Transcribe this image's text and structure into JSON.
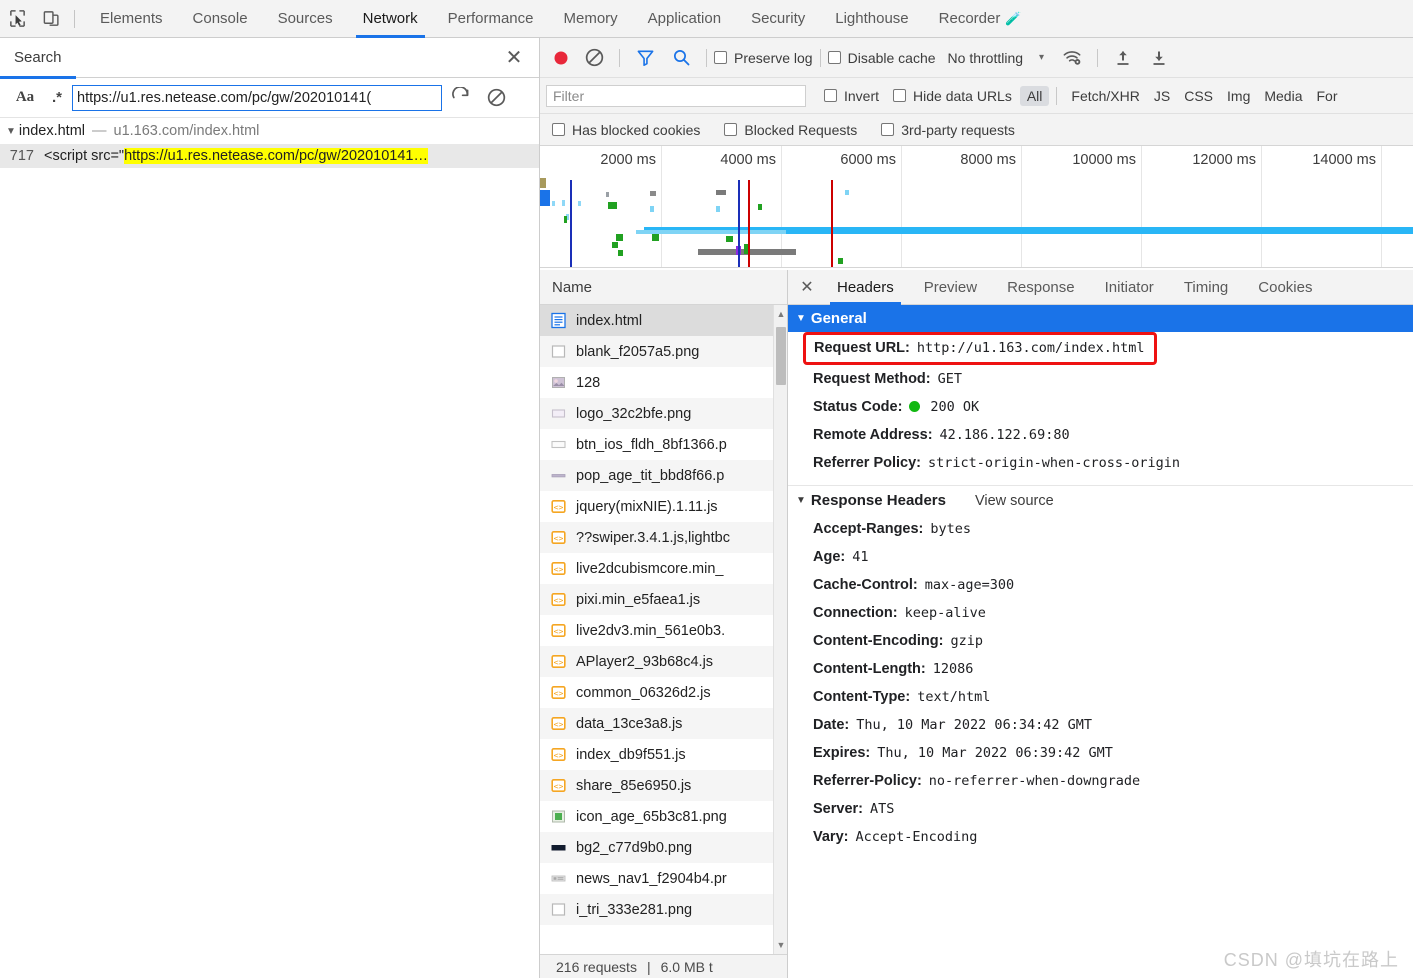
{
  "devtools": {
    "tabs": [
      {
        "label": "Elements",
        "active": false
      },
      {
        "label": "Console",
        "active": false
      },
      {
        "label": "Sources",
        "active": false
      },
      {
        "label": "Network",
        "active": true
      },
      {
        "label": "Performance",
        "active": false
      },
      {
        "label": "Memory",
        "active": false
      },
      {
        "label": "Application",
        "active": false
      },
      {
        "label": "Security",
        "active": false
      },
      {
        "label": "Lighthouse",
        "active": false
      },
      {
        "label": "Recorder",
        "active": false,
        "badge": "flask-icon"
      }
    ],
    "inspect_icon": "inspect-cursor-icon",
    "device_icon": "device-toolbar-icon",
    "accent_color": "#1a73e8"
  },
  "search_drawer": {
    "title": "Search",
    "close_icon": "close-icon",
    "match_case_label": "Aa",
    "regex_label": ".*",
    "query_value": "https://u1.res.netease.com/pc/gw/202010141(",
    "query_placeholder": "",
    "refresh_icon": "refresh-icon",
    "clear_icon": "clear-icon",
    "results": {
      "file": "index.html",
      "separator": "—",
      "file_url": "u1.163.com/index.html",
      "matches": [
        {
          "line": "717",
          "prefix": "<script src=\"",
          "highlight": "https://u1.res.netease.com/pc/gw/202010141…"
        }
      ]
    }
  },
  "network": {
    "toolbar": {
      "record_icon": "record-stop-icon",
      "clear_icon": "clear-network-icon",
      "filter_icon": "filter-icon",
      "search_icon": "search-icon",
      "preserve_log": {
        "label": "Preserve log",
        "checked": false
      },
      "disable_cache": {
        "label": "Disable cache",
        "checked": false
      },
      "throttling": "No throttling",
      "throttling_caret": "▾",
      "network_conditions_icon": "wifi-settings-icon",
      "import_icon": "import-har-icon",
      "export_icon": "export-har-icon"
    },
    "filter": {
      "placeholder": "Filter",
      "value": "",
      "invert": {
        "label": "Invert",
        "checked": false
      },
      "hide_data_urls": {
        "label": "Hide data URLs",
        "checked": false
      },
      "types": [
        {
          "label": "All",
          "selected": true
        },
        {
          "label": "Fetch/XHR",
          "selected": false
        },
        {
          "label": "JS",
          "selected": false
        },
        {
          "label": "CSS",
          "selected": false
        },
        {
          "label": "Img",
          "selected": false
        },
        {
          "label": "Media",
          "selected": false
        },
        {
          "label": "For",
          "selected": false
        }
      ]
    },
    "checkboxes": [
      {
        "label": "Has blocked cookies",
        "checked": false
      },
      {
        "label": "Blocked Requests",
        "checked": false
      },
      {
        "label": "3rd-party requests",
        "checked": false
      }
    ],
    "overview": {
      "ticks": [
        "2000 ms",
        "4000 ms",
        "6000 ms",
        "8000 ms",
        "10000 ms",
        "12000 ms",
        "14000 ms"
      ],
      "dom_content_loaded_color": "#1a2fb8",
      "load_color": "#cc0000"
    },
    "list": {
      "column_header": "Name",
      "rows": [
        {
          "name": "index.html",
          "icon": "document-icon",
          "selected": true
        },
        {
          "name": "blank_f2057a5.png",
          "icon": "image-icon",
          "selected": false
        },
        {
          "name": "128",
          "icon": "image-thumb-icon",
          "selected": false
        },
        {
          "name": "logo_32c2bfe.png",
          "icon": "image-icon",
          "selected": false
        },
        {
          "name": "btn_ios_fldh_8bf1366.p",
          "icon": "image-icon",
          "selected": false
        },
        {
          "name": "pop_age_tit_bbd8f66.p",
          "icon": "image-icon",
          "selected": false
        },
        {
          "name": "jquery(mixNIE).1.11.js",
          "icon": "script-icon",
          "selected": false
        },
        {
          "name": "??swiper.3.4.1.js,lightbc",
          "icon": "script-icon",
          "selected": false
        },
        {
          "name": "live2dcubismcore.min_",
          "icon": "script-icon",
          "selected": false
        },
        {
          "name": "pixi.min_e5faea1.js",
          "icon": "script-icon",
          "selected": false
        },
        {
          "name": "live2dv3.min_561e0b3.",
          "icon": "script-icon",
          "selected": false
        },
        {
          "name": "APlayer2_93b68c4.js",
          "icon": "script-icon",
          "selected": false
        },
        {
          "name": "common_06326d2.js",
          "icon": "script-icon",
          "selected": false
        },
        {
          "name": "data_13ce3a8.js",
          "icon": "script-icon",
          "selected": false
        },
        {
          "name": "index_db9f551.js",
          "icon": "script-icon",
          "selected": false
        },
        {
          "name": "share_85e6950.js",
          "icon": "script-icon",
          "selected": false
        },
        {
          "name": "icon_age_65b3c81.png",
          "icon": "image-thumb-icon",
          "selected": false
        },
        {
          "name": "bg2_c77d9b0.png",
          "icon": "image-thumb-icon",
          "selected": false
        },
        {
          "name": "news_nav1_f2904b4.pr",
          "icon": "image-thumb-icon",
          "selected": false
        },
        {
          "name": "i_tri_333e281.png",
          "icon": "image-icon",
          "selected": false
        }
      ],
      "scroll_up_icon": "scroll-up-arrow-icon",
      "scroll_down_icon": "scroll-down-arrow-icon"
    },
    "status_bar": {
      "requests": "216 requests",
      "transferred": "6.0 MB t"
    }
  },
  "detail": {
    "close_icon": "close-icon",
    "tabs": [
      {
        "label": "Headers",
        "active": true
      },
      {
        "label": "Preview",
        "active": false
      },
      {
        "label": "Response",
        "active": false
      },
      {
        "label": "Initiator",
        "active": false
      },
      {
        "label": "Timing",
        "active": false
      },
      {
        "label": "Cookies",
        "active": false
      }
    ],
    "general": {
      "title": "General",
      "rows": [
        {
          "key": "Request URL:",
          "value": "http://u1.163.com/index.html",
          "boxed": true
        },
        {
          "key": "Request Method:",
          "value": "GET"
        },
        {
          "key": "Status Code:",
          "value": "200 OK",
          "status_dot": "#12b812"
        },
        {
          "key": "Remote Address:",
          "value": "42.186.122.69:80"
        },
        {
          "key": "Referrer Policy:",
          "value": "strict-origin-when-cross-origin"
        }
      ]
    },
    "response_headers": {
      "title": "Response Headers",
      "view_source": "View source",
      "rows": [
        {
          "key": "Accept-Ranges:",
          "value": "bytes"
        },
        {
          "key": "Age:",
          "value": "41"
        },
        {
          "key": "Cache-Control:",
          "value": "max-age=300"
        },
        {
          "key": "Connection:",
          "value": "keep-alive"
        },
        {
          "key": "Content-Encoding:",
          "value": "gzip"
        },
        {
          "key": "Content-Length:",
          "value": "12086"
        },
        {
          "key": "Content-Type:",
          "value": "text/html"
        },
        {
          "key": "Date:",
          "value": "Thu, 10 Mar 2022 06:34:42 GMT"
        },
        {
          "key": "Expires:",
          "value": "Thu, 10 Mar 2022 06:39:42 GMT"
        },
        {
          "key": "Referrer-Policy:",
          "value": "no-referrer-when-downgrade"
        },
        {
          "key": "Server:",
          "value": "ATS"
        },
        {
          "key": "Vary:",
          "value": "Accept-Encoding"
        }
      ]
    }
  },
  "watermark": "CSDN @填坑在路上"
}
